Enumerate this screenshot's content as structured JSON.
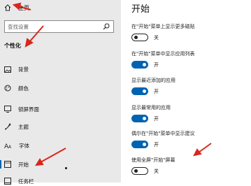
{
  "sidebar": {
    "home_label": "主页",
    "search_placeholder": "查找设置",
    "section_title": "个性化",
    "items": [
      {
        "label": "背景",
        "icon": "picture-icon"
      },
      {
        "label": "颜色",
        "icon": "palette-icon"
      },
      {
        "label": "锁屏界面",
        "icon": "lock-screen-icon"
      },
      {
        "label": "主题",
        "icon": "theme-icon"
      },
      {
        "label": "字体",
        "icon": "font-icon"
      },
      {
        "label": "开始",
        "icon": "start-icon"
      },
      {
        "label": "任务栏",
        "icon": "taskbar-icon"
      }
    ]
  },
  "main": {
    "title": "开始",
    "settings": [
      {
        "label": "在\"开始\"菜单上显示更多磁贴",
        "state": "关",
        "on": false
      },
      {
        "label": "在\"开始\"菜单中显示应用列表",
        "state": "开",
        "on": true
      },
      {
        "label": "显示最近添加的应用",
        "state": "开",
        "on": true
      },
      {
        "label": "显示最常用的应用",
        "state": "开",
        "on": true
      },
      {
        "label": "偶尔在\"开始\"菜单中显示建议",
        "state": "开",
        "on": true
      },
      {
        "label": "使用全屏\"开始\"屏幕",
        "state": "关",
        "on": false
      }
    ]
  },
  "colors": {
    "accent": "#0063b1",
    "annotation": "#d9261c",
    "sidebar_bg": "#e9e9e9"
  }
}
